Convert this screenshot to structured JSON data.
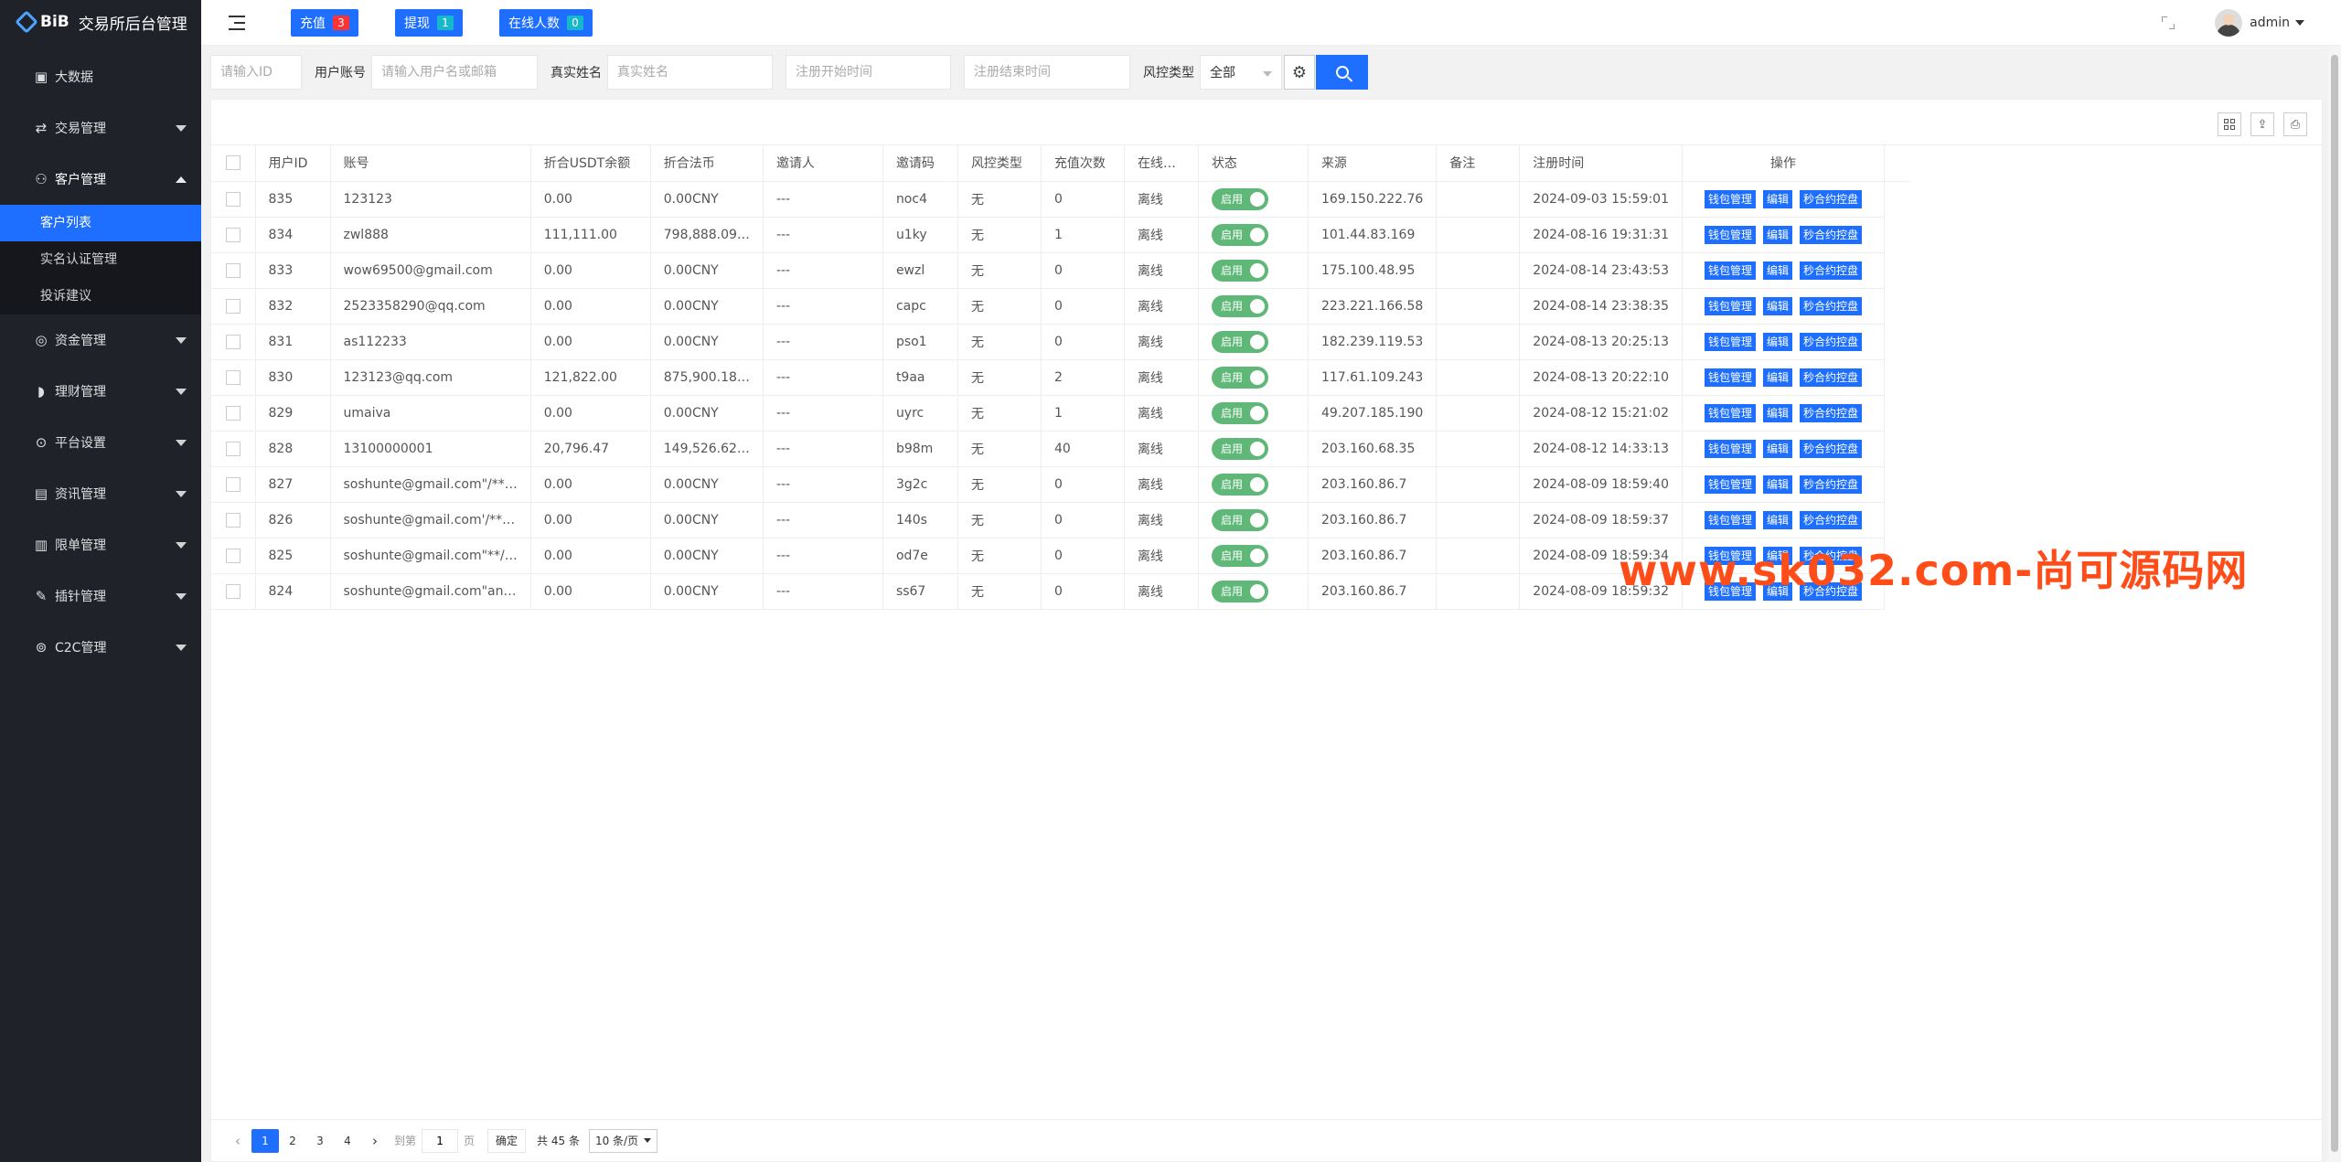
{
  "brand": {
    "logo": "BiB",
    "title": "交易所后台管理"
  },
  "sidebar": {
    "items": [
      {
        "label": "大数据",
        "icon": "dashboard-icon",
        "has_children": false
      },
      {
        "label": "交易管理",
        "icon": "exchange-icon",
        "has_children": true
      },
      {
        "label": "客户管理",
        "icon": "user-icon",
        "has_children": true,
        "open": true,
        "children": [
          {
            "label": "客户列表",
            "active": true
          },
          {
            "label": "实名认证管理"
          },
          {
            "label": "投诉建议"
          }
        ]
      },
      {
        "label": "资金管理",
        "icon": "money-icon",
        "has_children": true
      },
      {
        "label": "理财管理",
        "icon": "piggy-bank-icon",
        "has_children": true
      },
      {
        "label": "平台设置",
        "icon": "settings-icon",
        "has_children": true
      },
      {
        "label": "资讯管理",
        "icon": "news-icon",
        "has_children": true
      },
      {
        "label": "限单管理",
        "icon": "order-icon",
        "has_children": true
      },
      {
        "label": "插针管理",
        "icon": "pin-icon",
        "has_children": true
      },
      {
        "label": "C2C管理",
        "icon": "c2c-icon",
        "has_children": true
      }
    ]
  },
  "header": {
    "buttons": [
      {
        "label": "充值",
        "count": "3",
        "color": "#ff3333"
      },
      {
        "label": "提现",
        "count": "1",
        "color": "#16b9c9"
      },
      {
        "label": "在线人数",
        "count": "0",
        "color": "#16b9c9"
      }
    ],
    "user": "admin"
  },
  "filters": {
    "id_placeholder": "请输入ID",
    "account_label": "用户账号",
    "account_placeholder": "请输入用户名或邮箱",
    "realname_label": "真实姓名",
    "realname_placeholder": "真实姓名",
    "start_placeholder": "注册开始时间",
    "end_placeholder": "注册结束时间",
    "risk_label": "风控类型",
    "risk_value": "全部"
  },
  "table": {
    "columns": [
      "用户ID",
      "账号",
      "折合USDT余额",
      "折合法币",
      "邀请人",
      "邀请码",
      "风控类型",
      "充值次数",
      "在线…",
      "状态",
      "来源",
      "备注",
      "注册时间",
      "操作"
    ],
    "status_label": "启用",
    "actions": [
      "钱包管理",
      "编辑",
      "秒合约控盘"
    ],
    "rows": [
      {
        "id": "835",
        "account": "123123",
        "usdt": "0.00",
        "fiat": "0.00CNY",
        "inviter": "---",
        "code": "noc4",
        "risk": "无",
        "recharges": "0",
        "online": "离线",
        "source": "169.150.222.76",
        "note": "",
        "registered": "2024-09-03 15:59:01"
      },
      {
        "id": "834",
        "account": "zwl888",
        "usdt": "111,111.00",
        "fiat": "798,888.09…",
        "inviter": "---",
        "code": "u1ky",
        "risk": "无",
        "recharges": "1",
        "online": "离线",
        "source": "101.44.83.169",
        "note": "",
        "registered": "2024-08-16 19:31:31"
      },
      {
        "id": "833",
        "account": "wow69500@gmail.com",
        "usdt": "0.00",
        "fiat": "0.00CNY",
        "inviter": "---",
        "code": "ewzl",
        "risk": "无",
        "recharges": "0",
        "online": "离线",
        "source": "175.100.48.95",
        "note": "",
        "registered": "2024-08-14 23:43:53"
      },
      {
        "id": "832",
        "account": "2523358290@qq.com",
        "usdt": "0.00",
        "fiat": "0.00CNY",
        "inviter": "---",
        "code": "capc",
        "risk": "无",
        "recharges": "0",
        "online": "离线",
        "source": "223.221.166.58",
        "note": "",
        "registered": "2024-08-14 23:38:35"
      },
      {
        "id": "831",
        "account": "as112233",
        "usdt": "0.00",
        "fiat": "0.00CNY",
        "inviter": "---",
        "code": "pso1",
        "risk": "无",
        "recharges": "0",
        "online": "离线",
        "source": "182.239.119.53",
        "note": "",
        "registered": "2024-08-13 20:25:13"
      },
      {
        "id": "830",
        "account": "123123@qq.com",
        "usdt": "121,822.00",
        "fiat": "875,900.18…",
        "inviter": "---",
        "code": "t9aa",
        "risk": "无",
        "recharges": "2",
        "online": "离线",
        "source": "117.61.109.243",
        "note": "",
        "registered": "2024-08-13 20:22:10"
      },
      {
        "id": "829",
        "account": "umaiva",
        "usdt": "0.00",
        "fiat": "0.00CNY",
        "inviter": "---",
        "code": "uyrc",
        "risk": "无",
        "recharges": "1",
        "online": "离线",
        "source": "49.207.185.190",
        "note": "",
        "registered": "2024-08-12 15:21:02"
      },
      {
        "id": "828",
        "account": "13100000001",
        "usdt": "20,796.47",
        "fiat": "149,526.62…",
        "inviter": "---",
        "code": "b98m",
        "risk": "无",
        "recharges": "40",
        "online": "离线",
        "source": "203.160.68.35",
        "note": "",
        "registered": "2024-08-12 14:33:13"
      },
      {
        "id": "827",
        "account": "soshunte@gmail.com\"/**…",
        "usdt": "0.00",
        "fiat": "0.00CNY",
        "inviter": "---",
        "code": "3g2c",
        "risk": "无",
        "recharges": "0",
        "online": "离线",
        "source": "203.160.86.7",
        "note": "",
        "registered": "2024-08-09 18:59:40"
      },
      {
        "id": "826",
        "account": "soshunte@gmail.com'/**…",
        "usdt": "0.00",
        "fiat": "0.00CNY",
        "inviter": "---",
        "code": "140s",
        "risk": "无",
        "recharges": "0",
        "online": "离线",
        "source": "203.160.86.7",
        "note": "",
        "registered": "2024-08-09 18:59:37"
      },
      {
        "id": "825",
        "account": "soshunte@gmail.com\"**/…",
        "usdt": "0.00",
        "fiat": "0.00CNY",
        "inviter": "---",
        "code": "od7e",
        "risk": "无",
        "recharges": "0",
        "online": "离线",
        "source": "203.160.86.7",
        "note": "",
        "registered": "2024-08-09 18:59:34"
      },
      {
        "id": "824",
        "account": "soshunte@gmail.com\"an…",
        "usdt": "0.00",
        "fiat": "0.00CNY",
        "inviter": "---",
        "code": "ss67",
        "risk": "无",
        "recharges": "0",
        "online": "离线",
        "source": "203.160.86.7",
        "note": "",
        "registered": "2024-08-09 18:59:32"
      }
    ]
  },
  "pagination": {
    "pages": [
      "1",
      "2",
      "3",
      "4"
    ],
    "current": "1",
    "goto_label": "到第",
    "goto_value": "1",
    "page_unit": "页",
    "confirm": "确定",
    "total": "共 45 条",
    "page_size": "10 条/页"
  },
  "watermark": "www.sk032.com-尚可源码网"
}
